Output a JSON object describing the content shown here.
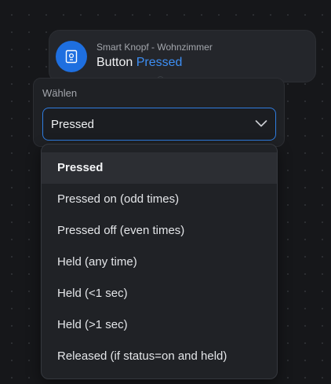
{
  "node": {
    "subtitle": "Smart Knopf - Wohnzimmer",
    "title_prefix": "Button",
    "title_state": "Pressed",
    "icon": "button-device-icon"
  },
  "selector": {
    "label": "Wählen",
    "value": "Pressed",
    "chevron_icon": "chevron-down-icon"
  },
  "dropdown": {
    "options": [
      "Pressed",
      "Pressed on (odd times)",
      "Pressed off (even times)",
      "Held (any time)",
      "Held (<1 sec)",
      "Held (>1 sec)",
      "Released (if status=on and held)"
    ],
    "selected": "Pressed"
  },
  "colors": {
    "accent": "#3d8ff5",
    "avatar": "#1e6fe0",
    "focus_border": "#2f7de1",
    "background": "#16171a"
  }
}
